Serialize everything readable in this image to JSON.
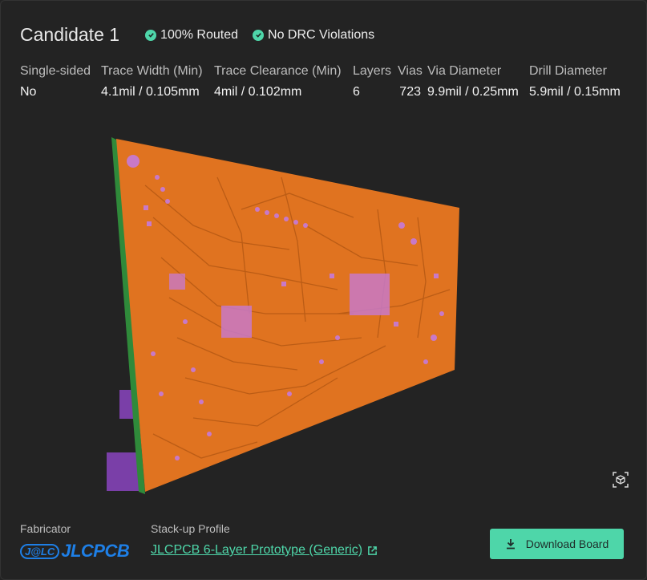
{
  "candidate": {
    "title": "Candidate 1",
    "badges": [
      {
        "label": "100% Routed",
        "icon": "check-circle-icon"
      },
      {
        "label": "No DRC Violations",
        "icon": "check-circle-icon"
      }
    ]
  },
  "specs": {
    "headers": [
      "Single-sided",
      "Trace Width (Min)",
      "Trace Clearance (Min)",
      "Layers",
      "Vias",
      "Via Diameter",
      "Drill Diameter"
    ],
    "values": [
      "No",
      "4.1mil / 0.105mm",
      "4mil / 0.102mm",
      "6",
      "723",
      "9.9mil / 0.25mm",
      "5.9mil / 0.15mm"
    ]
  },
  "viewer": {
    "board_color": "#e07320",
    "edge_color": "#2f8a3a",
    "pad_color": "#c879c8",
    "connector_color": "#7a3fa8",
    "view_icon": "3d-cube-icon"
  },
  "footer": {
    "fabricator_label": "Fabricator",
    "fabricator_logo_mark": "J@LC",
    "fabricator_logo_text": "JLCPCB",
    "stackup_label": "Stack-up Profile",
    "stackup_link": "JLCPCB 6-Layer Prototype (Generic)",
    "download_label": "Download Board",
    "accent": "#4ed6a9"
  }
}
